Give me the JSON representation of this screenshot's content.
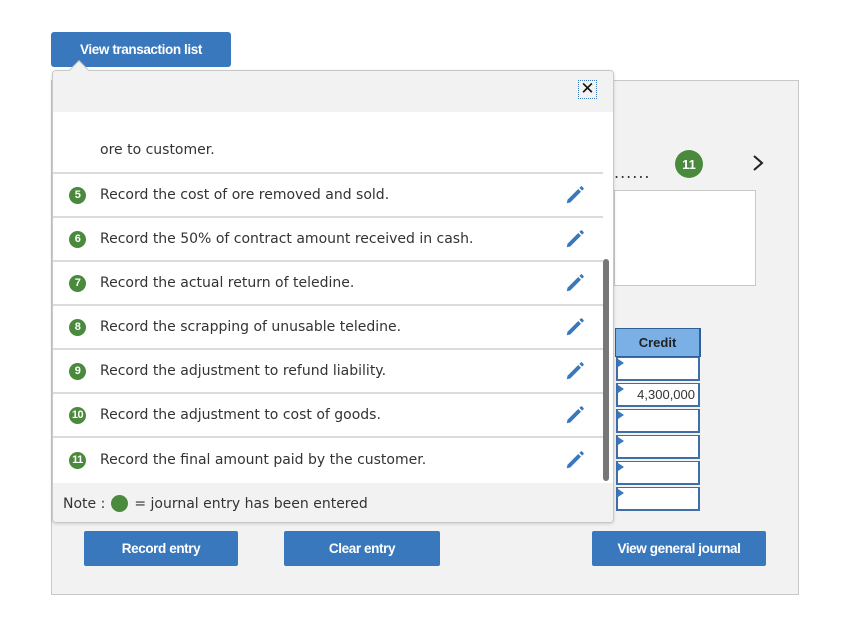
{
  "toolbar": {
    "view_transaction_list_label": "View transaction list"
  },
  "navigator": {
    "dots": "......",
    "current_step": "11",
    "next_icon": "chevron-right"
  },
  "popover": {
    "close_label": "✕",
    "items": [
      {
        "num": "",
        "text": "ore to customer.",
        "completed": true,
        "partial": true
      },
      {
        "num": "5",
        "text": "Record the cost of ore removed and sold.",
        "completed": true
      },
      {
        "num": "6",
        "text": "Record the 50% of contract amount received in cash.",
        "completed": true
      },
      {
        "num": "7",
        "text": "Record the actual return of teledine.",
        "completed": true
      },
      {
        "num": "8",
        "text": "Record the scrapping of unusable teledine.",
        "completed": true
      },
      {
        "num": "9",
        "text": "Record the adjustment to refund liability.",
        "completed": true
      },
      {
        "num": "10",
        "text": "Record the adjustment to cost of goods.",
        "completed": true
      },
      {
        "num": "11",
        "text": "Record the final amount paid by the customer.",
        "completed": true
      }
    ],
    "note_prefix": "Note :",
    "note_suffix": "= journal entry has been entered"
  },
  "journal": {
    "credit_header": "Credit",
    "credit_values": [
      "",
      "4,300,000",
      "",
      "",
      "",
      ""
    ]
  },
  "buttons": {
    "record_entry": "Record entry",
    "clear_entry": "Clear entry",
    "view_general_journal": "View general journal"
  },
  "colors": {
    "accent": "#3a78bd",
    "completed": "#4a8a3c",
    "header_blue": "#7ab0e6"
  }
}
